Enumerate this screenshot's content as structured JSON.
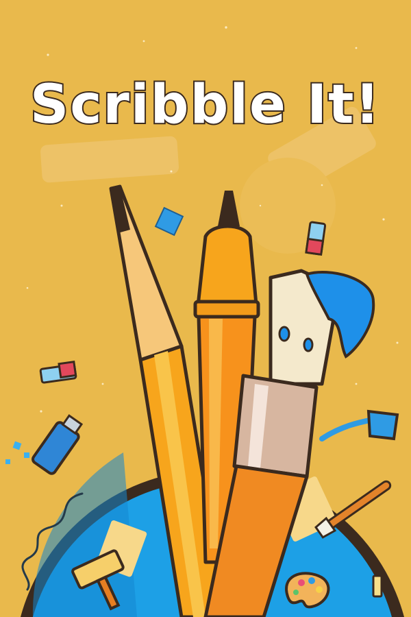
{
  "app": {
    "title": "Scribble It!"
  },
  "palette": {
    "background": "#e9b94c",
    "globe": "#1da0e6",
    "outline": "#3b2a1e",
    "pencil": "#f7a51c",
    "marker": "#f39b1a",
    "brush_handle": "#f08a22",
    "paint_blue": "#1e90e9"
  },
  "icons": [
    "pencil-icon",
    "marker-icon",
    "paintbrush-icon",
    "eraser-icon",
    "paint-tube-icon",
    "paint-cup-icon",
    "palette-icon",
    "paint-roller-icon",
    "small-brush-icon"
  ]
}
